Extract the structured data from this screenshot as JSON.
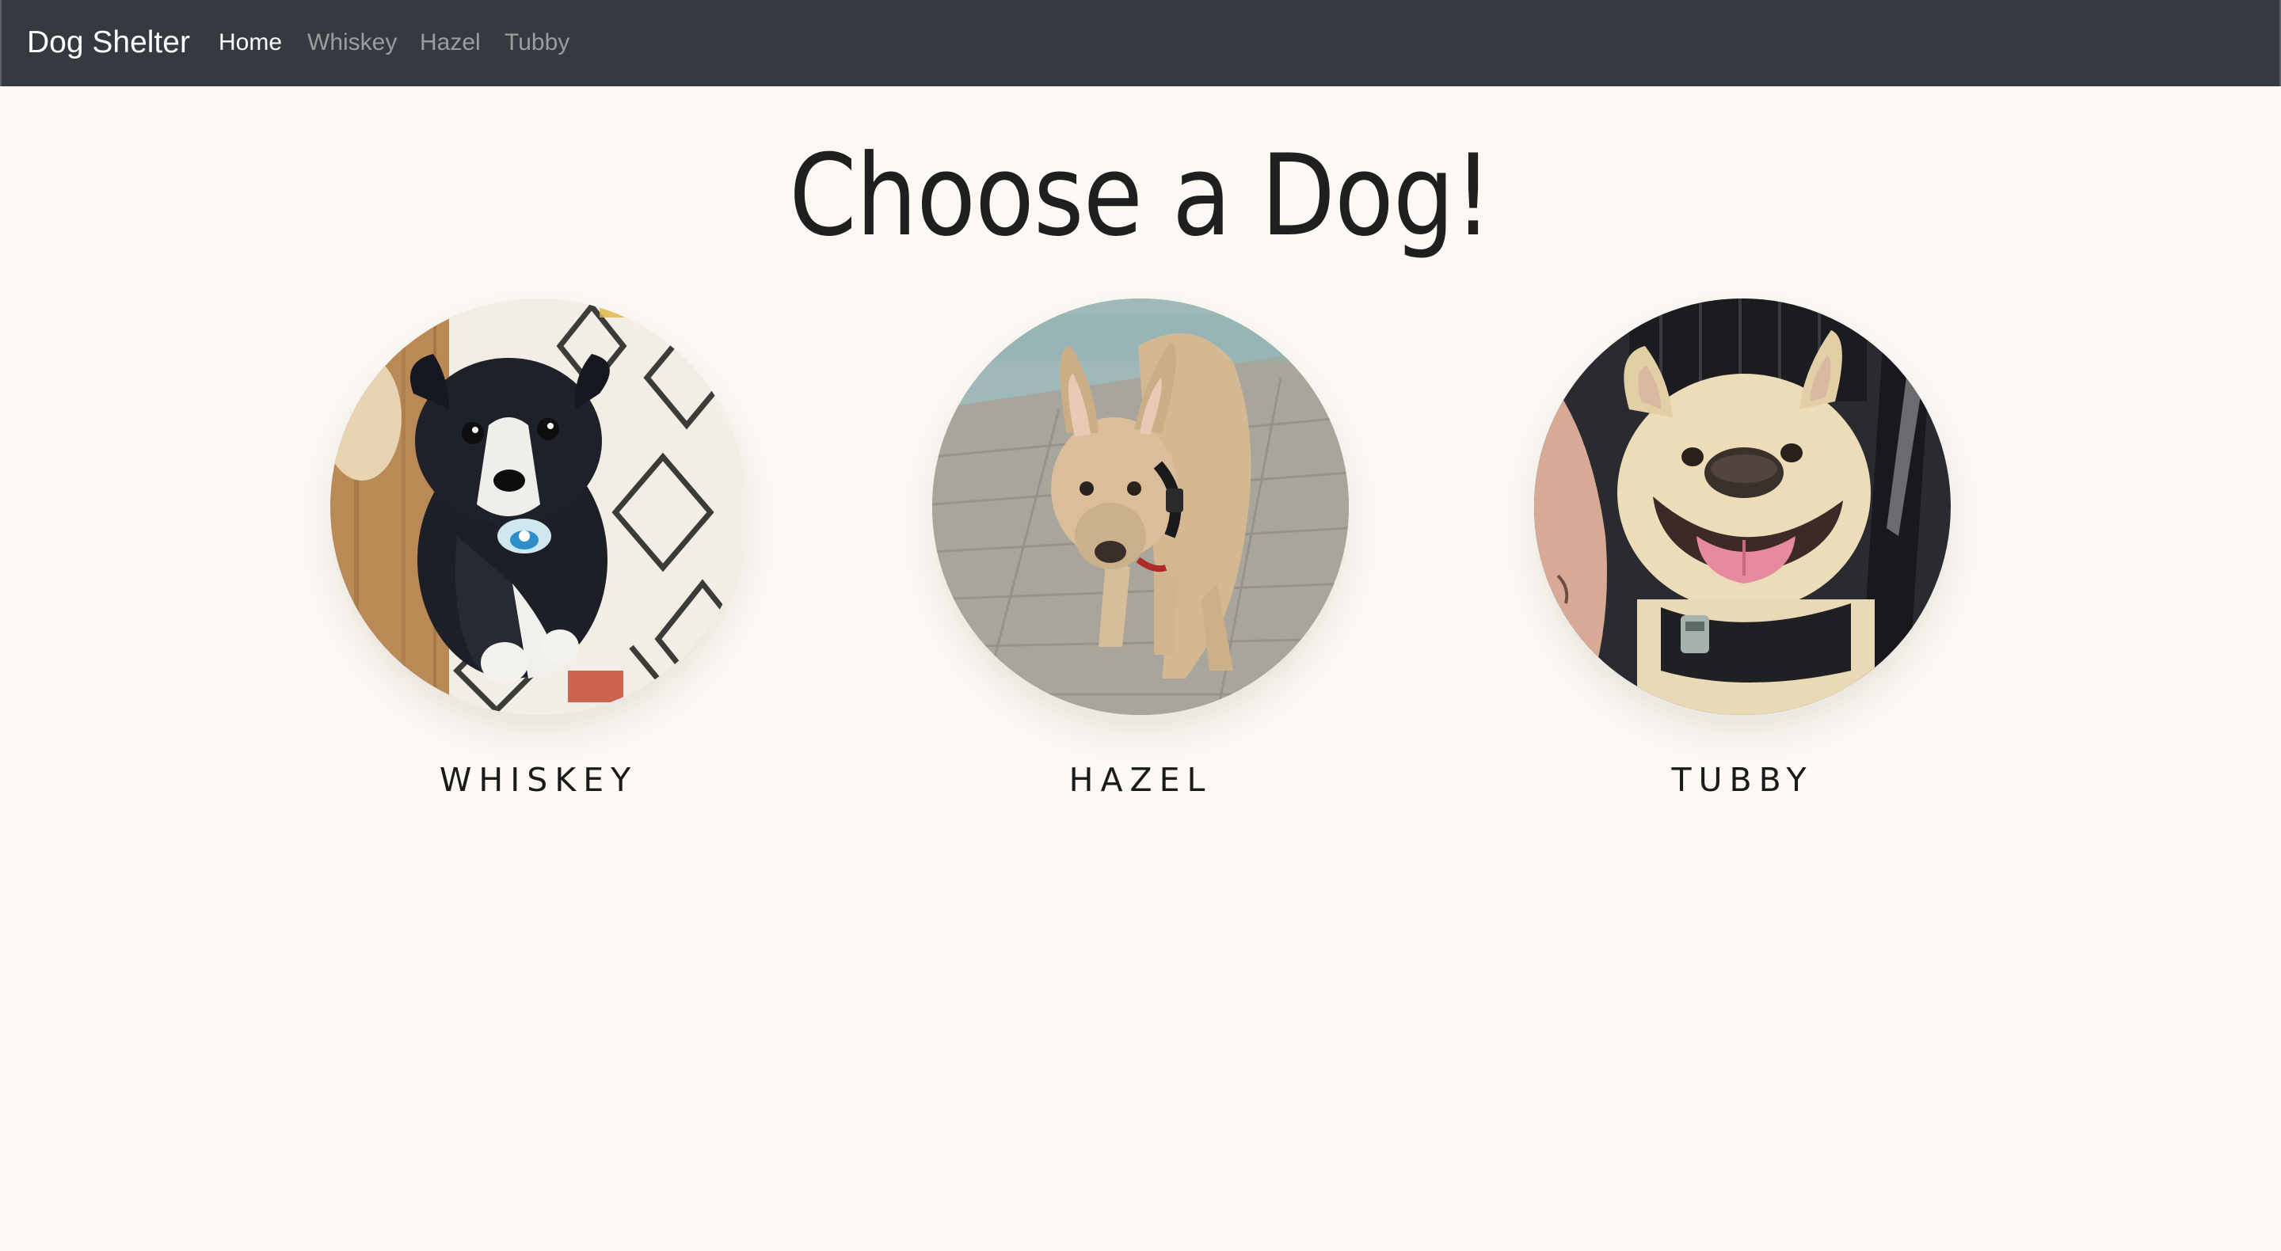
{
  "navbar": {
    "brand": "Dog Shelter",
    "links": [
      {
        "label": "Home",
        "active": true
      },
      {
        "label": "Whiskey",
        "active": false
      },
      {
        "label": "Hazel",
        "active": false
      },
      {
        "label": "Tubby",
        "active": false
      }
    ]
  },
  "main": {
    "title": "Choose a Dog!",
    "dogs": [
      {
        "name": "Whiskey",
        "photo_icon": "whiskey-photo"
      },
      {
        "name": "Hazel",
        "photo_icon": "hazel-photo"
      },
      {
        "name": "Tubby",
        "photo_icon": "tubby-photo"
      }
    ]
  },
  "colors": {
    "navbar_bg": "#343a40",
    "page_bg": "#fcf9f5",
    "nav_inactive": "rgba(255,255,255,0.5)"
  }
}
